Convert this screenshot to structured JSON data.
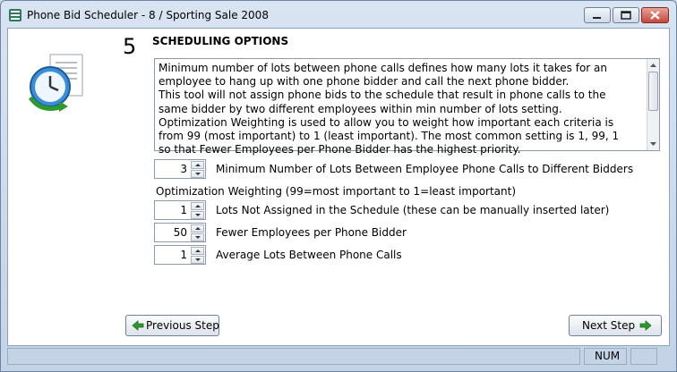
{
  "window": {
    "title": "Phone Bid Scheduler - 8 / Sporting Sale 2008",
    "controls": [
      "minimize-icon",
      "maximize-icon",
      "close-icon"
    ]
  },
  "step": {
    "number": "5",
    "title": "SCHEDULING OPTIONS",
    "description": "Minimum number of lots between phone calls defines how many lots it takes for an\nemployee to hang up with one phone bidder and call the next phone bidder.\nThis tool will not assign phone bids to the schedule that result in phone calls to the\nsame bidder by two different employees within min number of lots setting.\nOptimization Weighting is used to allow you to weight how important each criteria is\nfrom 99 (most important) to 1 (least important). The most common setting is 1, 99, 1\nso that Fewer Employees per Phone Bidder has the highest priority."
  },
  "options": {
    "min_lots": {
      "value": "3",
      "label": "Minimum Number of Lots Between Employee Phone Calls to Different Bidders"
    },
    "weighting_heading": "Optimization Weighting (99=most important to 1=least important)",
    "weights": [
      {
        "value": "1",
        "label": "Lots Not Assigned in the Schedule (these can be manually inserted later)"
      },
      {
        "value": "50",
        "label": "Fewer Employees per Phone Bidder"
      },
      {
        "value": "1",
        "label": "Average Lots Between Phone Calls"
      }
    ]
  },
  "nav": {
    "previous": "Previous Step",
    "next": "Next Step"
  },
  "status": {
    "num": "NUM"
  },
  "colors": {
    "accent_arrow": "#2e9a2e",
    "window_frame": "#6d83a3",
    "close_button": "#c7463a"
  }
}
